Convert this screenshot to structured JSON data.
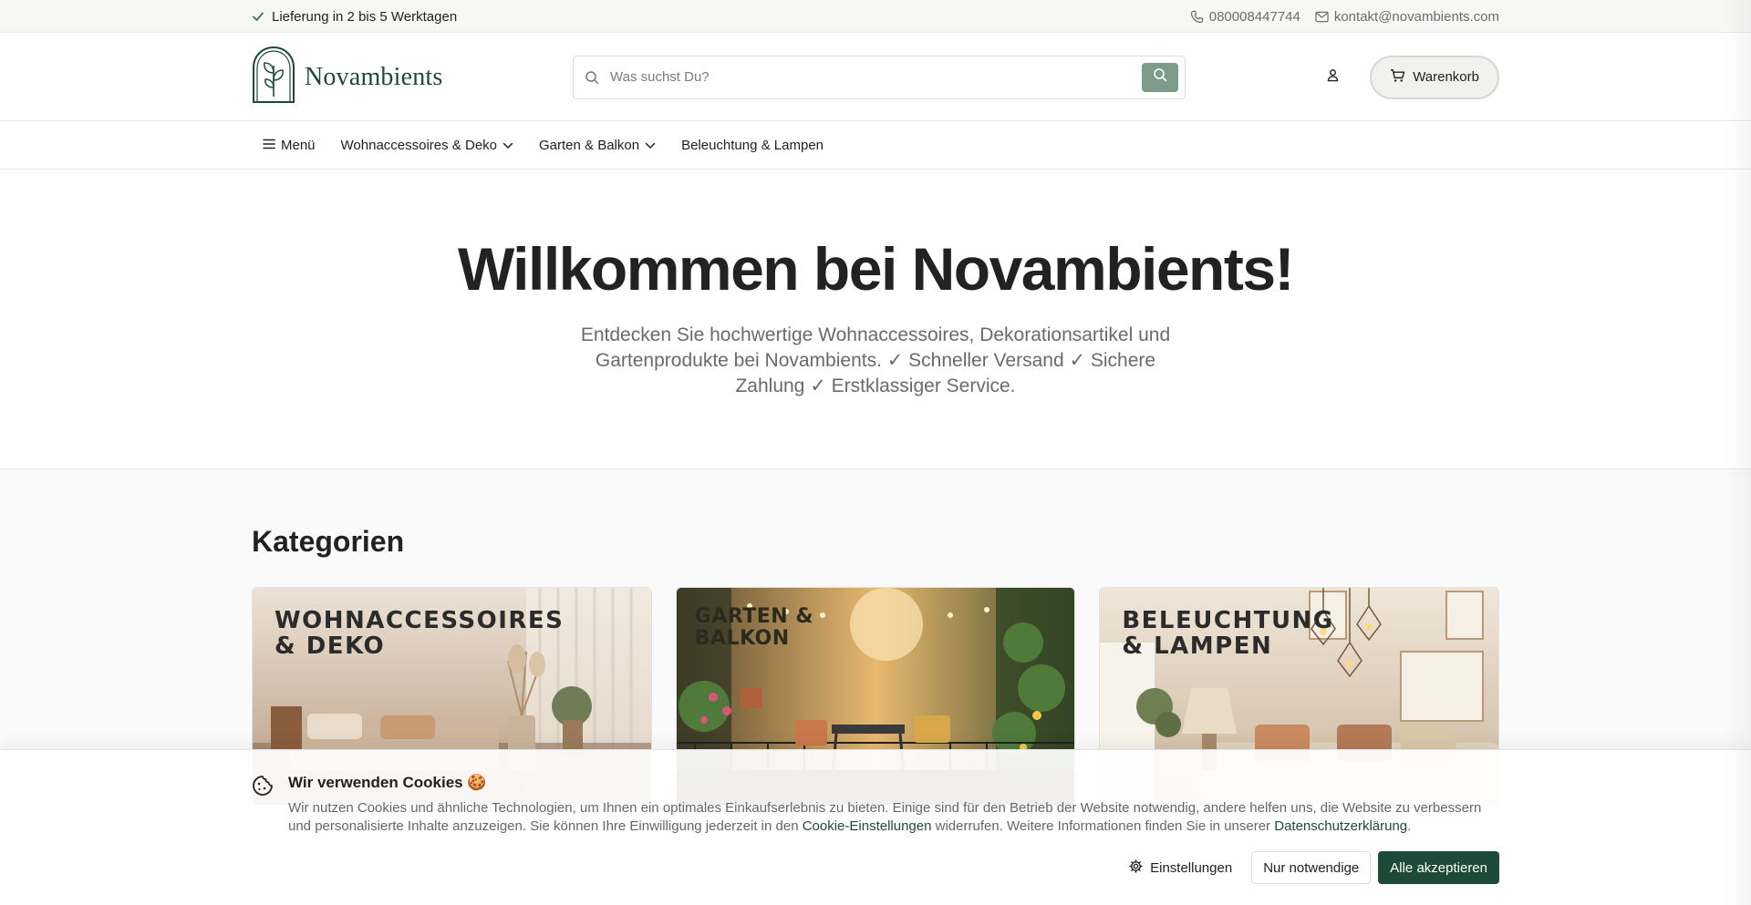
{
  "topbar": {
    "delivery": "Lieferung in 2 bis 5 Werktagen",
    "phone": "080008447744",
    "email": "kontakt@novambients.com"
  },
  "header": {
    "brand": "Novambients",
    "search_placeholder": "Was suchst Du?",
    "cart_label": "Warenkorb"
  },
  "nav": {
    "menu_label": "Menü",
    "items": [
      {
        "label": "Wohnaccessoires & Deko",
        "has_dropdown": true
      },
      {
        "label": "Garten & Balkon",
        "has_dropdown": true
      },
      {
        "label": "Beleuchtung & Lampen",
        "has_dropdown": false
      }
    ]
  },
  "hero": {
    "title": "Willkommen bei Novambients!",
    "subtitle": "Entdecken Sie hochwertige Wohnaccessoires, Dekorationsartikel und Gartenprodukte bei Novambients. ✓ Schneller Versand ✓ Sichere Zahlung ✓ Erstklassiger Service."
  },
  "categories": {
    "heading": "Kategorien",
    "cards": [
      {
        "caption_line1": "WOHNACCESSOIRES",
        "caption_line2": "& DEKO"
      },
      {
        "caption_line1": "GARTEN &",
        "caption_line2": "BALKON"
      },
      {
        "caption_line1": "BELEUCHTUNG",
        "caption_line2": "& LAMPEN"
      }
    ]
  },
  "cookie": {
    "title": "Wir verwenden Cookies 🍪",
    "text_part1": "Wir nutzen Cookies und ähnliche Technologien, um Ihnen ein optimales Einkaufserlebnis zu bieten. Einige sind für den Betrieb der Website notwendig, andere helfen uns, die Website zu verbessern und personalisierte Inhalte anzuzeigen. Sie können Ihre Einwilligung jederzeit in den ",
    "settings_link": "Cookie-Einstellungen",
    "text_part2": " widerrufen. Weitere Informationen finden Sie in unserer ",
    "privacy_link": "Datenschutzerklärung",
    "text_part3": ".",
    "btn_settings": "Einstellungen",
    "btn_necessary": "Nur notwendige",
    "btn_accept": "Alle akzeptieren"
  },
  "colors": {
    "brand_green": "#1e4a3a",
    "search_button": "#7d9a8b",
    "check_green": "#2d7a55"
  }
}
